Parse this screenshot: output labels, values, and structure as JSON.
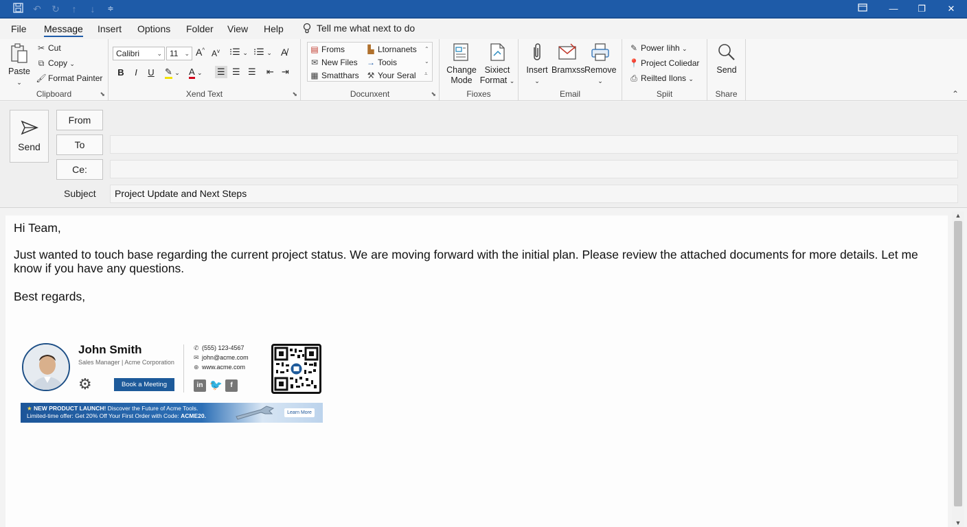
{
  "window": {
    "minimize": "—",
    "restore": "❐",
    "close": "✕"
  },
  "menu": {
    "tabs": [
      "File",
      "Message",
      "Insert",
      "Options",
      "Folder",
      "View",
      "Help"
    ],
    "tell_me": "Tell me what next to do"
  },
  "ribbon": {
    "clipboard": {
      "paste": "Paste",
      "cut": "Cut",
      "copy": "Copy",
      "format_painter": "Format Painter",
      "label": "Clipboard"
    },
    "text": {
      "font": "Calibri",
      "size": "11",
      "grow": "A",
      "shrink": "A",
      "bold": "B",
      "italic": "I",
      "underline": "U",
      "label": "Xend Text"
    },
    "document": {
      "froms": "Froms",
      "new_files": "New Files",
      "smatthars": "Smatthars",
      "ltornanets": "Ltornanets",
      "toois": "Toois",
      "your_seral": "Your Seral",
      "label": "Docunxent"
    },
    "fioxes": {
      "change_mode": "Change Mode",
      "sixiect_format": "Sixiect Format",
      "label": "Fioxes"
    },
    "email": {
      "insert": "Insert",
      "bramxss": "Bramxss",
      "remove": "Remove",
      "label": "Email"
    },
    "spiit": {
      "power": "Power Iihh",
      "project": "Project Coliedar",
      "reilted": "Reilted Ilons",
      "label": "Spiit"
    },
    "share": {
      "send": "Send",
      "label": "Share"
    }
  },
  "compose": {
    "send": "Send",
    "from": "From",
    "to": "To",
    "cc": "Ce:",
    "subject_label": "Subject",
    "subject_value": "Project Update and Next Steps",
    "to_value": "",
    "cc_value": "",
    "from_value": ""
  },
  "body": {
    "greeting": "Hi Team,",
    "paragraph_line1": "Just wanted to touch base regarding the current project status. We are moving forward with the initial plan. Please review the attached documents for more details. Let me",
    "paragraph_line2": "know if you have any questions.",
    "closing": "Best regards,"
  },
  "signature": {
    "name": "John Smith",
    "title": "Sales Manager | Acme Corporation",
    "book_button": "Book a Meeting",
    "phone": "(555) 123-4567",
    "email": "john@acme.com",
    "website": "www.acme.com",
    "social": [
      "in",
      "t",
      "f"
    ],
    "banner_headline": "NEW PRODUCT LAUNCH!",
    "banner_text": "Discover the Future of Acme Tools.",
    "banner_offer": "Limited-time offer: Get 20% Off Your First Order with Code:",
    "banner_code": "ACME20.",
    "banner_button": "Learn More"
  },
  "colors": {
    "titlebar": "#1e5ba8",
    "accent": "#1d5a9a"
  }
}
